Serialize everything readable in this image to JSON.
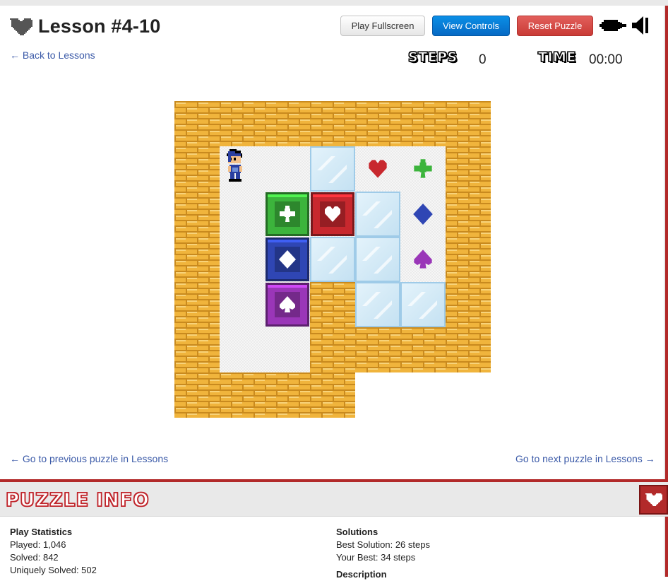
{
  "header": {
    "title": "Lesson #4-10",
    "back_link": "← Back to Lessons",
    "buttons": {
      "fullscreen": "Play Fullscreen",
      "controls": "View Controls",
      "reset": "Reset Puzzle"
    },
    "icons": {
      "title": "heart-icon",
      "music": "music-icon",
      "sound": "speaker-icon"
    }
  },
  "stats": {
    "steps_label": "STEPS",
    "steps_value": "0",
    "time_label": "TIME",
    "time_value": "00:00"
  },
  "board": {
    "grid_rows": [
      "WWWWWWW",
      "WFFIGGW",
      "WFBBIGW",
      "WFBIIGW",
      "WFBWIIW",
      "WFFWWWW",
      "WWWW..."
    ],
    "legend": {
      "W": "brick wall",
      "F": "floor",
      "I": "ice",
      "G": "goal floor",
      "B": "block",
      ".": "empty"
    },
    "player": {
      "row": 1,
      "col": 1
    },
    "blocks": [
      {
        "suit": "club",
        "color": "#3cb43c",
        "row": 2,
        "col": 2
      },
      {
        "suit": "heart",
        "color": "#c8282e",
        "row": 2,
        "col": 3
      },
      {
        "suit": "diamond",
        "color": "#2f46b4",
        "row": 3,
        "col": 2
      },
      {
        "suit": "spade",
        "color": "#9a36b8",
        "row": 4,
        "col": 2
      }
    ],
    "goals": [
      {
        "suit": "heart",
        "color": "#c8282e",
        "row": 1,
        "col": 4
      },
      {
        "suit": "club",
        "color": "#3cb43c",
        "row": 1,
        "col": 5
      },
      {
        "suit": "diamond",
        "color": "#2f46b4",
        "row": 2,
        "col": 5
      },
      {
        "suit": "spade",
        "color": "#9a36b8",
        "row": 3,
        "col": 5
      }
    ]
  },
  "nav": {
    "prev": "← Go to previous puzzle in Lessons",
    "next": "Go to next puzzle in Lessons →"
  },
  "info": {
    "title": "PUZZLE INFO",
    "play_statistics": {
      "heading": "Play Statistics",
      "played": "Played: 1,046",
      "solved": "Solved: 842",
      "uniquely_solved": "Uniquely Solved: 502"
    },
    "solutions": {
      "heading": "Solutions",
      "best": "Best Solution: 26 steps",
      "yours": "Your Best: 34 steps",
      "next_heading": "Description"
    }
  },
  "colors": {
    "brick": "#f0b43c",
    "mortar": "#c98a1e",
    "accent_red": "#b22a2a",
    "link": "#3b5aa8",
    "ice": "#cfe8f7"
  }
}
